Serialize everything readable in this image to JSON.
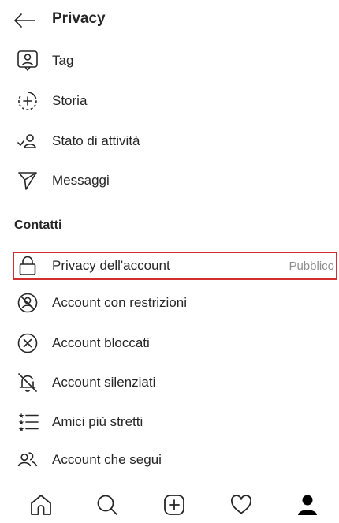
{
  "header": {
    "title": "Privacy",
    "back_icon": "arrow-left-icon"
  },
  "items_top": [
    {
      "label": "Tag",
      "icon": "tag-person-icon"
    },
    {
      "label": "Storia",
      "icon": "story-add-icon"
    },
    {
      "label": "Stato di attività",
      "icon": "activity-status-icon"
    },
    {
      "label": "Messaggi",
      "icon": "paper-plane-icon"
    }
  ],
  "section": {
    "title": "Contatti"
  },
  "items_contacts": [
    {
      "label": "Privacy dell'account",
      "value": "Pubblico",
      "icon": "lock-icon",
      "highlighted": true
    },
    {
      "label": "Account con restrizioni",
      "icon": "restricted-icon"
    },
    {
      "label": "Account bloccati",
      "icon": "blocked-icon"
    },
    {
      "label": "Account silenziati",
      "icon": "muted-bell-icon"
    },
    {
      "label": "Amici più stretti",
      "icon": "close-friends-list-icon"
    },
    {
      "label": "Account che segui",
      "icon": "following-icon"
    }
  ],
  "bottom_nav": [
    {
      "icon": "home-icon"
    },
    {
      "icon": "search-icon"
    },
    {
      "icon": "new-post-icon"
    },
    {
      "icon": "heart-icon"
    },
    {
      "icon": "profile-icon"
    }
  ],
  "colors": {
    "highlight_border": "#d32f2f",
    "text": "#262626",
    "secondary_text": "#8e8e8e"
  }
}
